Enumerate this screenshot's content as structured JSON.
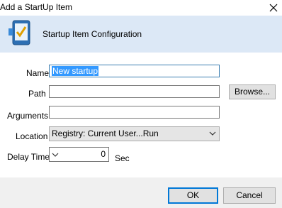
{
  "window": {
    "title": "Add a StartUp Item"
  },
  "header": {
    "title": "Startup Item Configuration",
    "icon": "startup-app-icon"
  },
  "form": {
    "name_label": "Name",
    "name_value": "New startup",
    "path_label": "Path",
    "path_value": "",
    "browse_label": "Browse...",
    "arguments_label": "Arguments",
    "arguments_value": "",
    "location_label": "Location",
    "location_value": "Registry: Current User...Run",
    "delay_label": "Delay Time",
    "delay_value": "0",
    "delay_unit": "Sec"
  },
  "buttons": {
    "ok": "OK",
    "cancel": "Cancel"
  },
  "colors": {
    "header_bg": "#dce8f6",
    "footer_bg": "#f0f0f0",
    "selection": "#3399ff",
    "default_button_border": "#0078d7"
  }
}
